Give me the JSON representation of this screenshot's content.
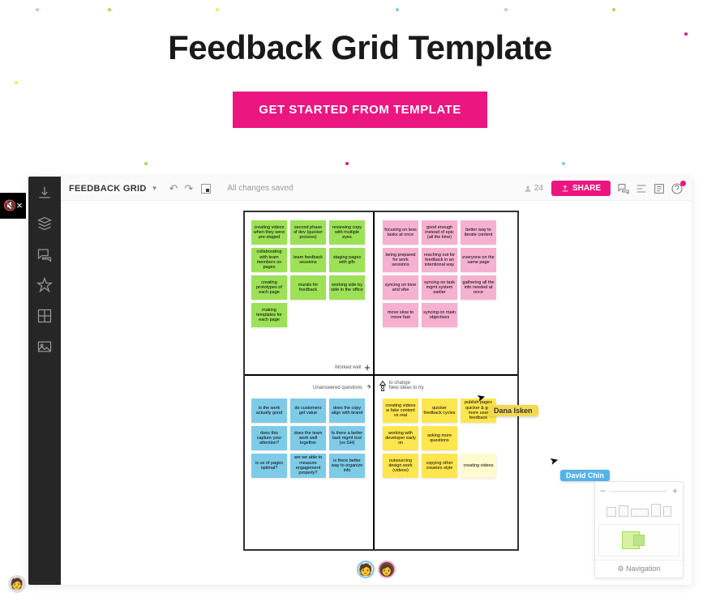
{
  "page": {
    "title": "Feedback Grid Template",
    "cta": "GET STARTED FROM TEMPLATE"
  },
  "mute": "🔇×",
  "topbar": {
    "doc_title": "FEEDBACK GRID",
    "saved": "All changes saved",
    "user_count": "24",
    "share": "SHARE"
  },
  "quadrants": {
    "tl_label": "Worked well",
    "tr_label": "to change",
    "bl_label": "Unanswered questions",
    "br_label": "New ideas to try"
  },
  "notes": {
    "green": [
      "creating videos when they were pre-staged",
      "second phase of dev (quicker process)",
      "reviewing copy with multiple eyes",
      "collaborating with team members on pages",
      "team feedback sessions",
      "staging pages with gifs",
      "creating prototypes of each page",
      "murals for feedback",
      "working side by side in the office",
      "making templates for each page"
    ],
    "pink": [
      "focusing on less tasks at once",
      "good enough instead of epic (all the time)",
      "better way to iterate content",
      "being prepared for work sessions",
      "reaching out for feedback in an intentional way",
      "everyone on the same page",
      "syncing on tone and vibe",
      "syncing on task mgmt system earlier",
      "gathering all the info needed at once",
      "move slow to move fast",
      "syncing on main objectives"
    ],
    "blue": [
      "Is the work actually good",
      "do customers get value",
      "does the copy align with brand",
      "does this capture your attention?",
      "does the team work well together",
      "Is there a better task mgmt tool (vs GH)",
      "is ux of pages optimal?",
      "are we able to measure engagement properly?",
      "is there better way to organize info"
    ],
    "yellow": [
      "creating videos w fake content vs real",
      "quicker feedback cycles",
      "publish pages quicker & get more user feedback",
      "working with developer early on",
      "asking more questions",
      "outsourcing design work (videos)",
      "copying other creators style",
      "creating videos"
    ]
  },
  "cursors": {
    "dana": "Dana Isken",
    "david": "David Chin"
  },
  "nav": {
    "label": "Navigation",
    "minus": "−",
    "plus": "+"
  },
  "colors": {
    "accent": "#ec1680",
    "dana_bg": "#f3d94e",
    "david_bg": "#53b4e8"
  }
}
